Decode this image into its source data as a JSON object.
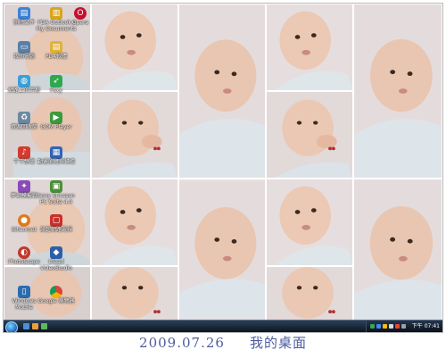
{
  "desktop": {
    "icons": [
      {
        "label": "刪除文件",
        "icon": "folder-icon",
        "color": "#3b82d6"
      },
      {
        "label": "我的電腦",
        "icon": "computer-icon",
        "color": "#5b7fa6"
      },
      {
        "label": "網路上的芳鄰",
        "icon": "network-icon",
        "color": "#3aa0d8"
      },
      {
        "label": "資源回收筒",
        "icon": "recycle-bin-icon",
        "color": "#6b8aa0"
      },
      {
        "label": "千千靜聽",
        "icon": "music-player-icon",
        "color": "#d23b2e"
      },
      {
        "label": "夢幻模擬戰",
        "icon": "game-icon",
        "color": "#8a4bb8"
      },
      {
        "label": "BitComet",
        "icon": "bitcomet-icon",
        "color": "#e07a1c"
      },
      {
        "label": "PhotoScape",
        "icon": "photoscape-icon",
        "color": "#c0392b"
      },
      {
        "label": "Windows Mobile",
        "icon": "windows-mobile-icon",
        "color": "#2b6cb0"
      },
      {
        "label": "PDA Outlook / My Documents",
        "icon": "documents-icon",
        "color": "#d9a520"
      },
      {
        "label": "PDA軟體",
        "icon": "folder-icon",
        "color": "#e0b23a"
      },
      {
        "label": "Foxy",
        "icon": "foxy-icon",
        "color": "#2fa84f"
      },
      {
        "label": "GOM Player",
        "icon": "gom-player-icon",
        "color": "#3c9a3c"
      },
      {
        "label": "動畫瀏覽與轉檔",
        "icon": "video-convert-icon",
        "color": "#3163b8"
      },
      {
        "label": "Sony Ericsson PC Suite 4.0",
        "icon": "pc-suite-icon",
        "color": "#4a8f3a"
      },
      {
        "label": "設定網路電視",
        "icon": "tv-icon",
        "color": "#c8312b"
      },
      {
        "label": "Ulead VideoStudio",
        "icon": "videostudio-icon",
        "color": "#2c5fa8"
      },
      {
        "label": "Google 瀏覽器",
        "icon": "chrome-icon",
        "color": "#2f8f46"
      },
      {
        "label": "Opera",
        "icon": "opera-icon",
        "color": "#c8102e"
      }
    ]
  },
  "taskbar": {
    "start_label": "Start",
    "clock": "下午 07:41",
    "quick_launch_colors": [
      "#4a90d9",
      "#e8a13a",
      "#5fb85f"
    ],
    "tray_colors": [
      "#34a853",
      "#4285f4",
      "#fbbc05",
      "#d9d9d9",
      "#ea4335",
      "#9aa0a6"
    ]
  },
  "caption": {
    "date": "2009.07.26",
    "title": "我的桌面"
  },
  "colors": {
    "caption_text": "#4e5d9e",
    "taskbar_top": "#2c3f57",
    "taskbar_bottom": "#0d1522"
  }
}
